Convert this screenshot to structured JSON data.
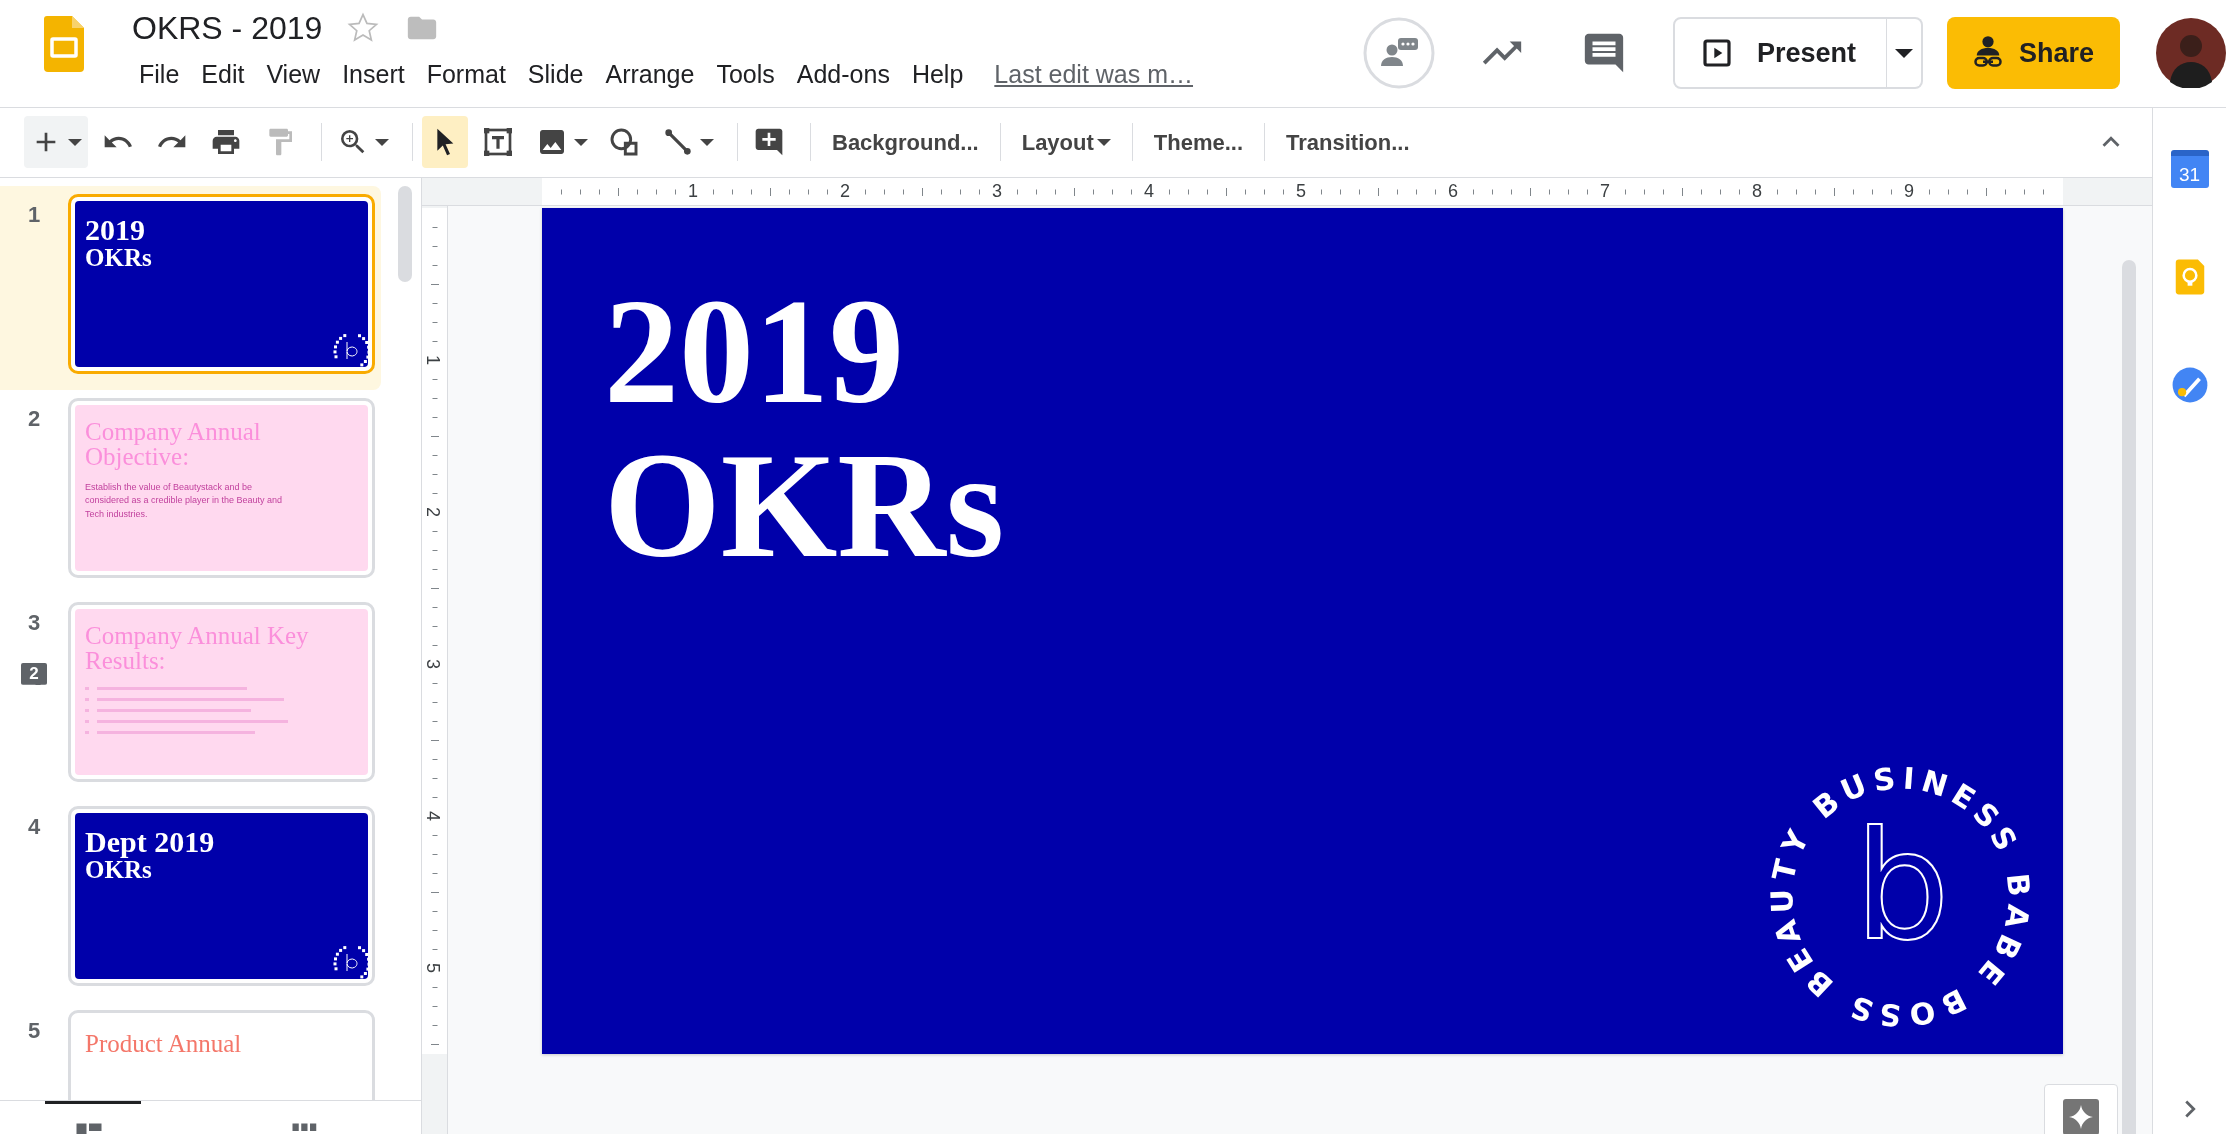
{
  "document": {
    "title": "OKRS - 2019",
    "starred": false
  },
  "menu": [
    {
      "label": "File"
    },
    {
      "label": "Edit"
    },
    {
      "label": "View"
    },
    {
      "label": "Insert"
    },
    {
      "label": "Format"
    },
    {
      "label": "Slide"
    },
    {
      "label": "Arrange"
    },
    {
      "label": "Tools"
    },
    {
      "label": "Add-ons"
    },
    {
      "label": "Help"
    }
  ],
  "last_edit": "Last edit was m…",
  "actions": {
    "present": "Present",
    "share": "Share"
  },
  "toolbar": {
    "groups": [
      [
        {
          "kind": "new-slide",
          "has_menu": true,
          "selected": false,
          "disabled": false
        },
        {
          "kind": "undo",
          "has_menu": false,
          "selected": false,
          "disabled": false
        },
        {
          "kind": "redo",
          "has_menu": false,
          "selected": false,
          "disabled": false
        },
        {
          "kind": "print",
          "has_menu": false,
          "selected": false,
          "disabled": false
        },
        {
          "kind": "paint-format",
          "has_menu": false,
          "selected": false,
          "disabled": true
        }
      ],
      [
        {
          "kind": "zoom",
          "has_menu": true,
          "selected": false,
          "disabled": false
        }
      ],
      [
        {
          "kind": "select",
          "has_menu": false,
          "selected": true,
          "disabled": false
        },
        {
          "kind": "text-box",
          "has_menu": false,
          "selected": false,
          "disabled": false
        },
        {
          "kind": "image",
          "has_menu": true,
          "selected": false,
          "disabled": false
        },
        {
          "kind": "shape",
          "has_menu": false,
          "selected": false,
          "disabled": false
        },
        {
          "kind": "line",
          "has_menu": true,
          "selected": false,
          "disabled": false
        }
      ],
      [
        {
          "kind": "add-comment",
          "has_menu": false,
          "selected": false,
          "disabled": false
        }
      ]
    ],
    "commands": [
      {
        "label": "Background...",
        "has_menu": false
      },
      {
        "label": "Layout",
        "has_menu": true
      },
      {
        "label": "Theme...",
        "has_menu": false
      },
      {
        "label": "Transition...",
        "has_menu": false
      }
    ]
  },
  "slides": [
    {
      "number": "1",
      "selected": true,
      "kind": "blue",
      "title": "2019",
      "subtitle": "OKRs",
      "logo": true
    },
    {
      "number": "2",
      "selected": false,
      "kind": "pink",
      "title": "Company Annual Objective:",
      "body": "Establish the value of Beautystack and be considered as a credible player in the Beauty and Tech industries."
    },
    {
      "number": "3",
      "selected": false,
      "kind": "pink-list",
      "title": "Company Annual Key Results:",
      "comments": "2"
    },
    {
      "number": "4",
      "selected": false,
      "kind": "blue",
      "title": "Dept 2019",
      "subtitle": "OKRs",
      "logo": true
    },
    {
      "number": "5",
      "selected": false,
      "kind": "white",
      "title": "Product Annual"
    }
  ],
  "ruler": {
    "horizontal": [
      "1",
      "2",
      "3",
      "4",
      "5",
      "6",
      "7",
      "8",
      "9"
    ],
    "vertical": [
      "1",
      "2",
      "3",
      "4",
      "5"
    ]
  },
  "canvas": {
    "title": "2019",
    "subtitle": "OKRs",
    "logo": {
      "ring_text": "BEAUTY BUSINESS BABE BOSS",
      "letter": "b"
    }
  },
  "side_panel": [
    {
      "kind": "calendar",
      "label": "31"
    },
    {
      "kind": "keep"
    },
    {
      "kind": "tasks"
    }
  ]
}
